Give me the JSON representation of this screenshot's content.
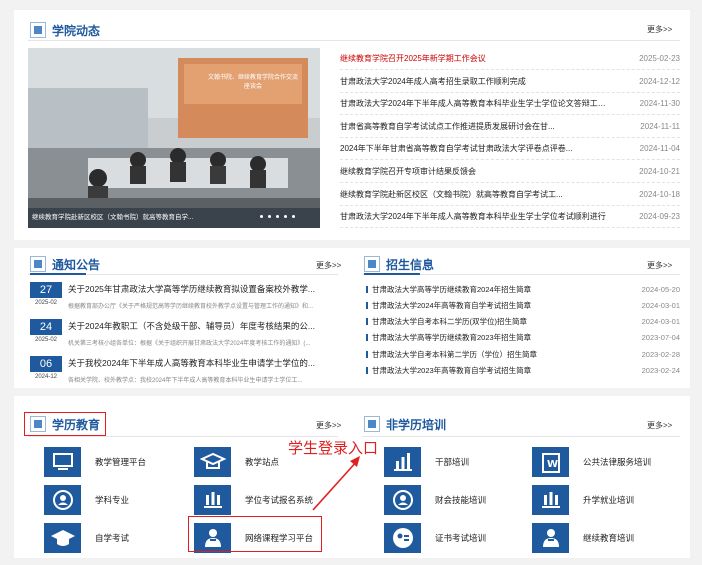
{
  "colors": {
    "brand": "#1f5a9e",
    "highlight": "#e02020"
  },
  "news": {
    "title": "学院动态",
    "more": "更多>>",
    "photo_caption": "继续教育学院赴新区校区（文翰书院）就高等教育自学...",
    "photo_banner": "文翰书院、继续教育学院合作交流座谈会",
    "items": [
      {
        "title": "继续教育学院召开2025年新学期工作会议",
        "date": "2025-02-23",
        "hot": true
      },
      {
        "title": "甘肃政法大学2024年成人高考招生录取工作顺利完成",
        "date": "2024-12-12"
      },
      {
        "title": "甘肃政法大学2024年下半年成人高等教育本科毕业生学士学位论文答辩工作...",
        "date": "2024-11-30"
      },
      {
        "title": "甘肃省高等教育自学考试试点工作推进提质发展研讨会在甘...",
        "date": "2024-11-11"
      },
      {
        "title": "2024年下半年甘肃省高等教育自学考试甘肃政法大学评卷点评卷...",
        "date": "2024-11-04"
      },
      {
        "title": "继续教育学院召开专项审计结果反馈会",
        "date": "2024-10-21"
      },
      {
        "title": "继续教育学院赴新区校区（文翰书院）就高等教育自学考试工...",
        "date": "2024-10-18"
      },
      {
        "title": "甘肃政法大学2024年下半年成人高等教育本科毕业生学士学位考试顺利进行",
        "date": "2024-09-23"
      }
    ]
  },
  "notices": {
    "title": "通知公告",
    "more": "更多>>",
    "items": [
      {
        "day": "27",
        "ym": "2025-02",
        "title": "关于2025年甘肃政法大学高等学历继续教育拟设置备案校外教学...",
        "desc": "根据教育部办公厅《关于严格规范高等学历继续教育校外教学点设置与管理工作的通知》和..."
      },
      {
        "day": "24",
        "ym": "2025-02",
        "title": "关于2024年教职工（不含处级干部、辅导员）年度考核结果的公...",
        "desc": "机关第三考核小组各单位：根据《关于组织开展甘肃政法大学2024年度考核工作的通知》(..."
      },
      {
        "day": "06",
        "ym": "2024-12",
        "title": "关于我校2024年下半年成人高等教育本科毕业生申请学士学位的...",
        "desc": "各相关学院、校外教学点：我校2024年下半年成人高等教育本科毕业生申请学士学位工..."
      }
    ]
  },
  "enroll": {
    "title": "招生信息",
    "more": "更多>>",
    "items": [
      {
        "title": "甘肃政法大学高等学历继续教育2024年招生简章",
        "date": "2024-05-20"
      },
      {
        "title": "甘肃政法大学2024年高等教育自学考试招生简章",
        "date": "2024-03-01"
      },
      {
        "title": "甘肃政法大学自考本科二学历(双学位)招生简章",
        "date": "2024-03-01"
      },
      {
        "title": "甘肃政法大学高等学历继续教育2023年招生简章",
        "date": "2023-07-04"
      },
      {
        "title": "甘肃政法大学自考本科第二学历（学位）招生简章",
        "date": "2023-02-28"
      },
      {
        "title": "甘肃政法大学2023年高等教育自学考试招生简章",
        "date": "2023-02-24"
      }
    ]
  },
  "edu": {
    "title": "学历教育",
    "more": "更多>>",
    "items": [
      {
        "label": "教学管理平台",
        "icon": "monitor-icon"
      },
      {
        "label": "教学站点",
        "icon": "graduation-cap-icon"
      },
      {
        "label": "学科专业",
        "icon": "user-circle-icon"
      },
      {
        "label": "学位考试报名系统",
        "icon": "building-icon"
      },
      {
        "label": "自学考试",
        "icon": "cap-icon"
      },
      {
        "label": "网络课程学习平台",
        "icon": "teacher-icon"
      }
    ]
  },
  "nonedu": {
    "title": "非学历培训",
    "more": "更多>>",
    "items": [
      {
        "label": "干部培训",
        "icon": "chart-icon"
      },
      {
        "label": "公共法律服务培训",
        "icon": "word-icon"
      },
      {
        "label": "财会技能培训",
        "icon": "user-circle-icon"
      },
      {
        "label": "升学就业培训",
        "icon": "building-icon"
      },
      {
        "label": "证书考试培训",
        "icon": "id-icon"
      },
      {
        "label": "继续教育培训",
        "icon": "teacher-icon"
      }
    ]
  },
  "annotation": {
    "label": "学生登录入口"
  }
}
